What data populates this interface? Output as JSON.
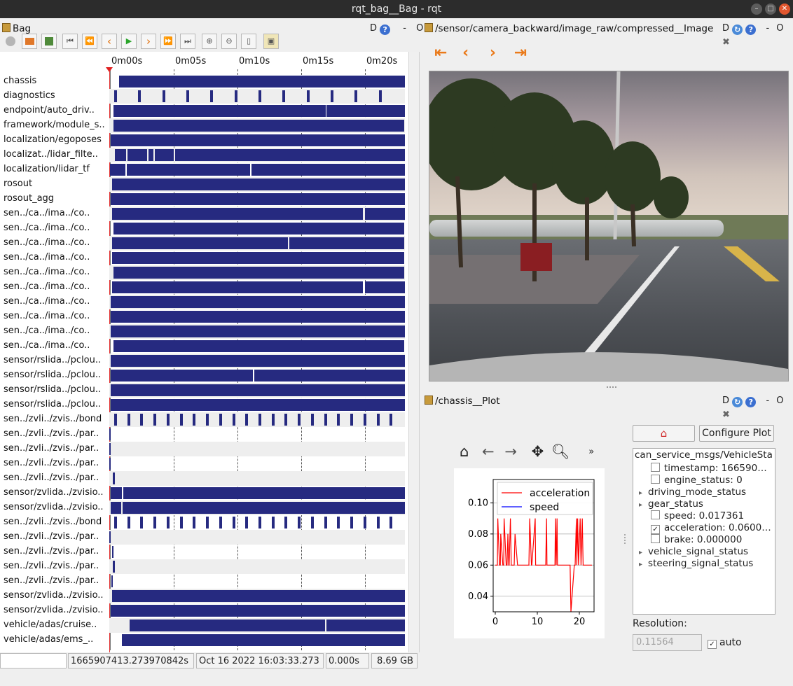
{
  "window": {
    "title": "rqt_bag__Bag - rqt"
  },
  "bag_panel": {
    "title": "Bag",
    "ctl_d": "D",
    "ctl_help": "?",
    "ctl_dash": "-",
    "ctl_o": "O"
  },
  "timeline": {
    "ticks": [
      "0m00s",
      "0m05s",
      "0m10s",
      "0m15s",
      "0m20s"
    ],
    "topics": [
      "chassis",
      "diagnostics",
      "endpoint/auto_driv..",
      "framework/module_s..",
      "localization/egoposes",
      "localizat../lidar_filte..",
      "localization/lidar_tf",
      "rosout",
      "rosout_agg",
      "sen../ca../ima../co..",
      "sen../ca../ima../co..",
      "sen../ca../ima../co..",
      "sen../ca../ima../co..",
      "sen../ca../ima../co..",
      "sen../ca../ima../co..",
      "sen../ca../ima../co..",
      "sen../ca../ima../co..",
      "sen../ca../ima../co..",
      "sen../ca../ima../co..",
      "sensor/rslida../pclou..",
      "sensor/rslida../pclou..",
      "sensor/rslida../pclou..",
      "sensor/rslida../pclou..",
      "sen../zvli../zvis../bond",
      "sen../zvli../zvis../par..",
      "sen../zvli../zvis../par..",
      "sen../zvli../zvis../par..",
      "sen../zvli../zvis../par..",
      "sensor/zvlida../zvisio..",
      "sensor/zvlida../zvisio..",
      "sen../zvli../zvis../bond",
      "sen../zvli../zvis../par..",
      "sen../zvli../zvis../par..",
      "sen../zvli../zvis../par..",
      "sen../zvli../zvis../par..",
      "sensor/zvlida../zvisio..",
      "sensor/zvlida../zvisio..",
      "vehicle/adas/cruise..",
      "vehicle/adas/ems_.."
    ]
  },
  "status": {
    "stamp": "1665907413.273970842s",
    "datetime": "Oct 16 2022 16:03:33.273",
    "offset": "0.000s",
    "size": "8.69 GB"
  },
  "image_panel": {
    "title": "/sensor/camera_backward/image_raw/compressed__Image",
    "ctl_d": "D",
    "ctl_dash": "-",
    "ctl_o": "O"
  },
  "plot_panel": {
    "title": "/chassis__Plot",
    "ctl_d": "D",
    "ctl_dash": "-",
    "ctl_o": "O",
    "configure_label": "Configure Plot",
    "more_label": "»"
  },
  "tree": {
    "root": "can_service_msgs/VehicleSta",
    "rows": [
      {
        "label": "timestamp:  166590…",
        "kind": "check",
        "checked": false
      },
      {
        "label": "engine_status:  0",
        "kind": "check",
        "checked": false
      },
      {
        "label": "driving_mode_status",
        "kind": "branch"
      },
      {
        "label": "gear_status",
        "kind": "branch"
      },
      {
        "label": "speed:  0.017361",
        "kind": "check",
        "checked": false
      },
      {
        "label": "acceleration:  0.0600…",
        "kind": "check",
        "checked": true
      },
      {
        "label": "brake:  0.000000",
        "kind": "check",
        "checked": false
      },
      {
        "label": "vehicle_signal_status",
        "kind": "branch"
      },
      {
        "label": "steering_signal_status",
        "kind": "branch"
      }
    ]
  },
  "resolution": {
    "label": "Resolution:",
    "value": "0.11564",
    "auto_label": "auto",
    "auto_checked": true
  },
  "chart_data": {
    "type": "line",
    "series": [
      {
        "name": "acceleration",
        "color": "#ff0000",
        "x": [
          0,
          0.5,
          0.6,
          1,
          1.2,
          1.3,
          1.8,
          2,
          2.1,
          2.6,
          2.8,
          3,
          3.2,
          3.3,
          3.6,
          3.8,
          3.9,
          4.5,
          4.7,
          5.3,
          5.4,
          8,
          8.2,
          8.6,
          8.7,
          9.5,
          9.6,
          12,
          12.2,
          12.3,
          14.2,
          14.3,
          14.5,
          14.7,
          14.8,
          17.8,
          18,
          18.8,
          19,
          19.3,
          19.4,
          19.6,
          19.8,
          20.2,
          20.4,
          20.7,
          20.9,
          23
        ],
        "y": [
          0.06,
          0.06,
          0.09,
          0.06,
          0.06,
          0.08,
          0.06,
          0.06,
          0.09,
          0.06,
          0.06,
          0.08,
          0.06,
          0.06,
          0.09,
          0.06,
          0.06,
          0.06,
          0.08,
          0.06,
          0.06,
          0.06,
          0.09,
          0.06,
          0.06,
          0.09,
          0.06,
          0.06,
          0.09,
          0.06,
          0.06,
          0.09,
          0.06,
          0.09,
          0.06,
          0.06,
          0.03,
          0.06,
          0.06,
          0.09,
          0.06,
          0.09,
          0.06,
          0.09,
          0.06,
          0.09,
          0.06,
          0.06
        ]
      },
      {
        "name": "speed",
        "color": "#0000ff",
        "x": [],
        "y": []
      }
    ],
    "xlim": [
      -0.5,
      23.5
    ],
    "ylim": [
      0.03,
      0.115
    ],
    "xticks": [
      0,
      10,
      20
    ],
    "yticks": [
      0.04,
      0.06,
      0.08,
      0.1
    ],
    "ytick_labels": [
      "0.04",
      "0.06",
      "0.08",
      "0.10"
    ],
    "grid": true,
    "legend": "top-right"
  }
}
